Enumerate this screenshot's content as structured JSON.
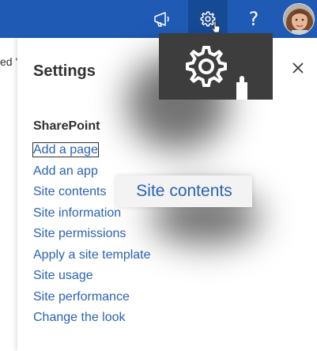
{
  "topbar": {
    "megaphone_icon": "megaphone-icon",
    "settings_icon": "gear-icon",
    "help_label": "?",
    "avatar_icon": "user-avatar"
  },
  "left_page": {
    "fragment": "ed '"
  },
  "panel": {
    "title": "Settings",
    "section_title": "SharePoint",
    "links": [
      "Add a page",
      "Add an app",
      "Site contents",
      "Site information",
      "Site permissions",
      "Apply a site template",
      "Site usage",
      "Site performance",
      "Change the look"
    ]
  },
  "tooltip": {
    "text": "Site contents"
  },
  "colors": {
    "topbar": "#1f5bb5",
    "topbar_active": "#164a95",
    "link": "#2b62b2",
    "text": "#323130",
    "zoom_bg": "#3d3d3d"
  }
}
